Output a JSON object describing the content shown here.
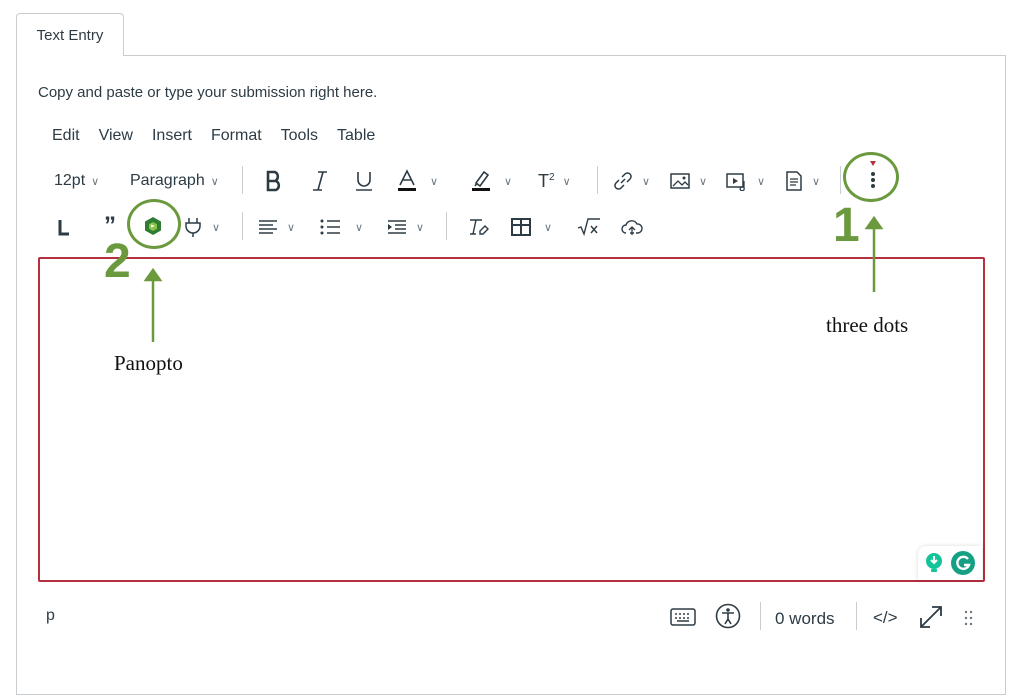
{
  "tab": {
    "label": "Text Entry"
  },
  "hint": "Copy and paste or type your submission right here.",
  "menubar": {
    "items": [
      "Edit",
      "View",
      "Insert",
      "Format",
      "Tools",
      "Table"
    ]
  },
  "toolbar": {
    "font_size": "12pt",
    "block_format": "Paragraph",
    "superscript_label": "T",
    "superscript_sup": "2",
    "quote_glyph": "”"
  },
  "statusbar": {
    "path": "p",
    "word_count": "0 words",
    "html_toggle": "</>"
  },
  "annotations": {
    "num1": "1",
    "num2": "2",
    "label1": "three dots",
    "label2": "Panopto"
  },
  "colors": {
    "accent_green": "#6a9a3d",
    "editor_border": "#b4303c",
    "text": "#2d3b45"
  }
}
